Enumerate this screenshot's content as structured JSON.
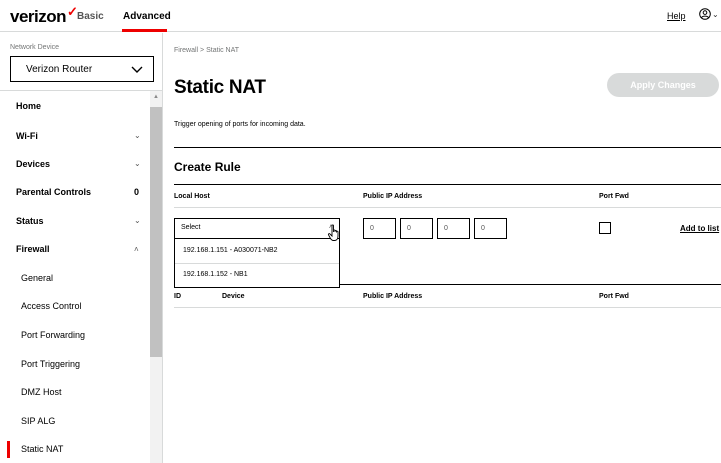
{
  "header": {
    "logo_text": "verizon",
    "logo_mark": "✓",
    "tabs": [
      {
        "label": "Basic",
        "active": false
      },
      {
        "label": "Advanced",
        "active": true
      }
    ],
    "help_label": "Help",
    "user_icon": "user-circle-icon",
    "accent_color": "#ee0000"
  },
  "sidebar": {
    "network_device_label": "Network Device",
    "device_select_value": "Verizon Router",
    "items": [
      {
        "label": "Home"
      },
      {
        "label": "Wi-Fi",
        "icon": "chevron-down-icon"
      },
      {
        "label": "Devices",
        "icon": "chevron-down-icon"
      },
      {
        "label": "Parental Controls",
        "count": "0"
      },
      {
        "label": "Status",
        "icon": "chevron-down-icon"
      },
      {
        "label": "Firewall",
        "icon": "chevron-up-icon",
        "expanded": true
      }
    ],
    "firewall_subitems": [
      {
        "label": "General"
      },
      {
        "label": "Access Control"
      },
      {
        "label": "Port Forwarding"
      },
      {
        "label": "Port Triggering"
      },
      {
        "label": "DMZ Host"
      },
      {
        "label": "SIP ALG"
      },
      {
        "label": "Static NAT",
        "active": true
      }
    ]
  },
  "main": {
    "breadcrumb": "Firewall  >  Static NAT",
    "title": "Static NAT",
    "apply_button": "Apply Changes",
    "description": "Trigger opening of ports for incoming data.",
    "create_rule": {
      "title": "Create Rule",
      "columns": {
        "local_host": "Local Host",
        "public_ip": "Public IP Address",
        "port_fwd": "Port Fwd"
      },
      "host_select": {
        "value": "Select",
        "options": [
          "192.168.1.151 - A030071-NB2",
          "192.168.1.152 - NB1"
        ]
      },
      "ip_octets": [
        "0",
        "0",
        "0",
        "0"
      ],
      "port_fwd_checked": false,
      "add_link": "Add to list"
    },
    "rules_table": {
      "columns": {
        "id": "ID",
        "device": "Device",
        "public_ip": "Public IP Address",
        "port_fwd": "Port Fwd"
      }
    }
  }
}
